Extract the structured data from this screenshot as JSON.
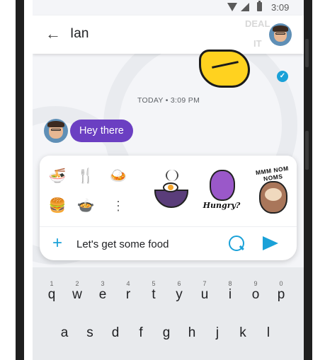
{
  "status_bar": {
    "time": "3:09"
  },
  "header": {
    "back_icon": "back-arrow-icon",
    "contact_name": "Ian"
  },
  "conversation": {
    "timestamp": "TODAY • 3:09 PM",
    "incoming_message": "Hey there"
  },
  "watermark": {
    "line1": "DEAL",
    "line2": "IT"
  },
  "suggestion_tray": {
    "emojis": [
      "ramen-bowl-icon",
      "fork-knife-icon",
      "curry-rice-icon",
      "burger-icon",
      "soup-bowl-icon",
      "more-vertical-icon"
    ],
    "stickers": {
      "hungry_caption": "Hungry?",
      "nom_caption": "MMM NOM NOMS"
    }
  },
  "composer": {
    "text": "Let's get some food"
  },
  "keyboard": {
    "row1": [
      {
        "num": "1",
        "ch": "q"
      },
      {
        "num": "2",
        "ch": "w"
      },
      {
        "num": "3",
        "ch": "e"
      },
      {
        "num": "4",
        "ch": "r"
      },
      {
        "num": "5",
        "ch": "t"
      },
      {
        "num": "6",
        "ch": "y"
      },
      {
        "num": "7",
        "ch": "u"
      },
      {
        "num": "8",
        "ch": "i"
      },
      {
        "num": "9",
        "ch": "o"
      },
      {
        "num": "0",
        "ch": "p"
      }
    ],
    "row2": [
      "a",
      "s",
      "d",
      "f",
      "g",
      "h",
      "j",
      "k",
      "l"
    ]
  },
  "colors": {
    "accent": "#1aa1d8",
    "bubble_purple": "#6b3fc2",
    "background": "#f4f5f8"
  }
}
